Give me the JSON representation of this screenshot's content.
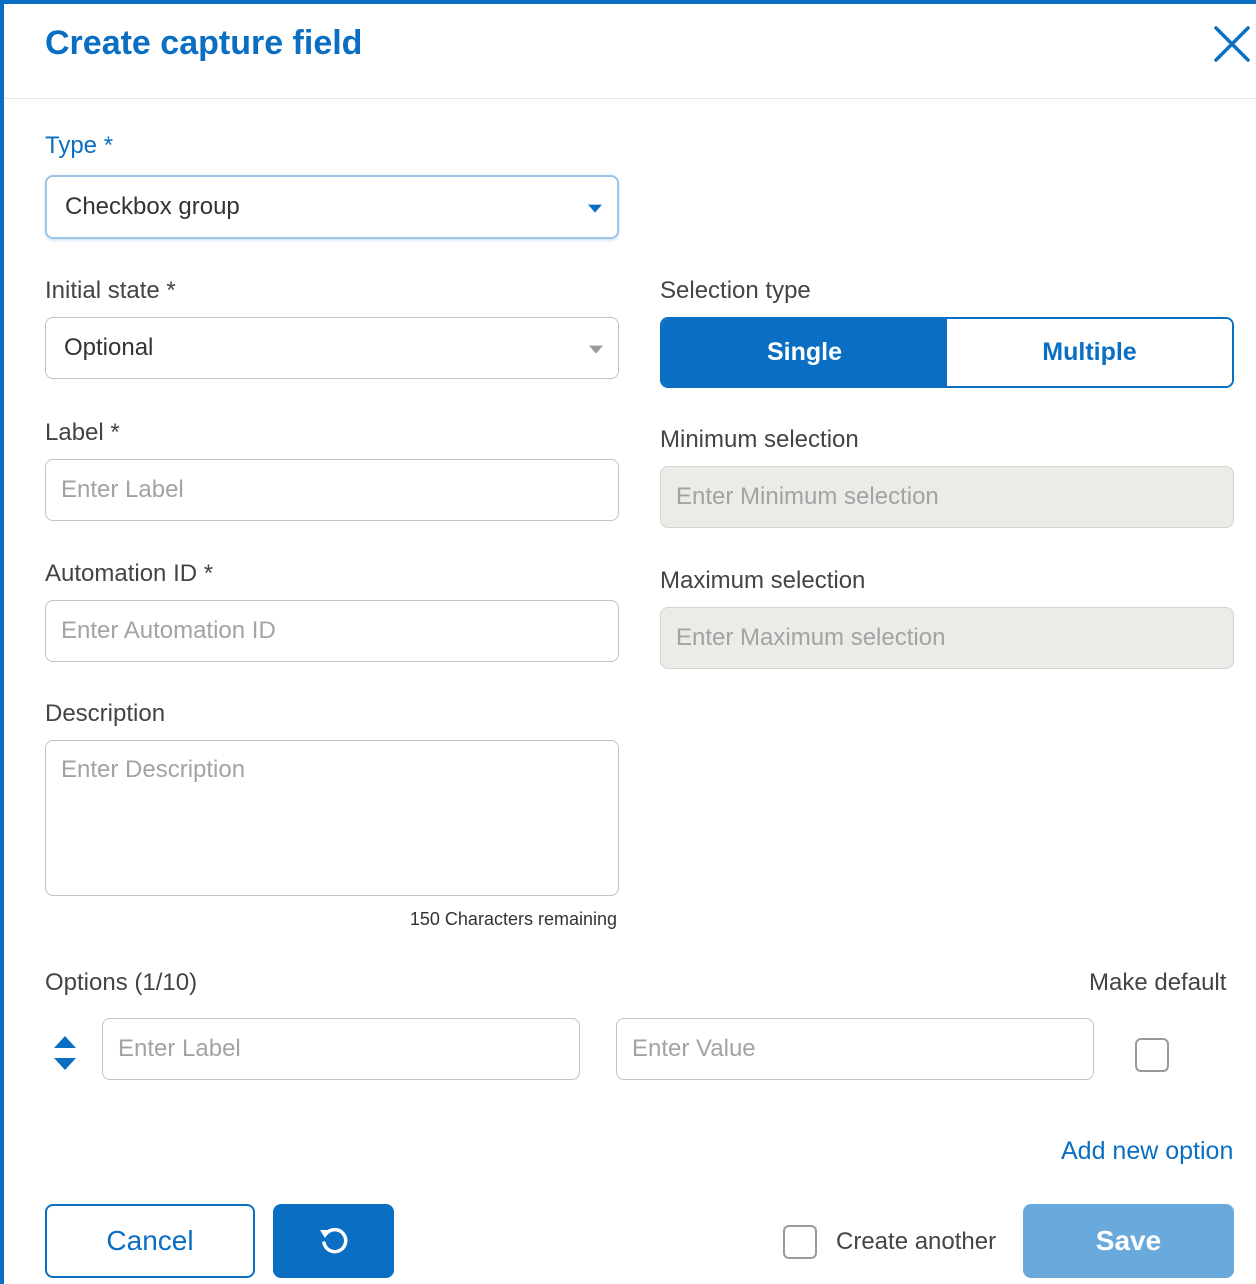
{
  "dialog": {
    "title": "Create capture field"
  },
  "icons": {
    "close": "close-icon",
    "type_caret": "chevron-down-icon",
    "state_caret": "chevron-down-icon",
    "sort": "sort-handle-icon",
    "reset": "refresh-icon"
  },
  "colors": {
    "accent": "#0a6fc2",
    "save_disabled": "#6aa9db",
    "disabled_field": "#ebebe8"
  },
  "form": {
    "type": {
      "label": "Type *",
      "value": "Checkbox group"
    },
    "initial_state": {
      "label": "Initial state *",
      "value": "Optional"
    },
    "label_field": {
      "label": "Label *",
      "placeholder": "Enter Label"
    },
    "automation_id": {
      "label": "Automation ID *",
      "placeholder": "Enter Automation ID"
    },
    "description": {
      "label": "Description",
      "placeholder": "Enter Description",
      "remaining": "150 Characters remaining"
    },
    "selection_type": {
      "label": "Selection type",
      "options": [
        "Single",
        "Multiple"
      ],
      "selected": "Single"
    },
    "min_selection": {
      "label": "Minimum selection",
      "placeholder": "Enter Minimum selection"
    },
    "max_selection": {
      "label": "Maximum selection",
      "placeholder": "Enter Maximum selection"
    }
  },
  "options": {
    "heading": "Options (1/10)",
    "make_default_label": "Make default",
    "row": {
      "label_placeholder": "Enter Label",
      "value_placeholder": "Enter Value"
    },
    "add_new": "Add new option"
  },
  "footer": {
    "cancel": "Cancel",
    "create_another": "Create another",
    "save": "Save"
  }
}
